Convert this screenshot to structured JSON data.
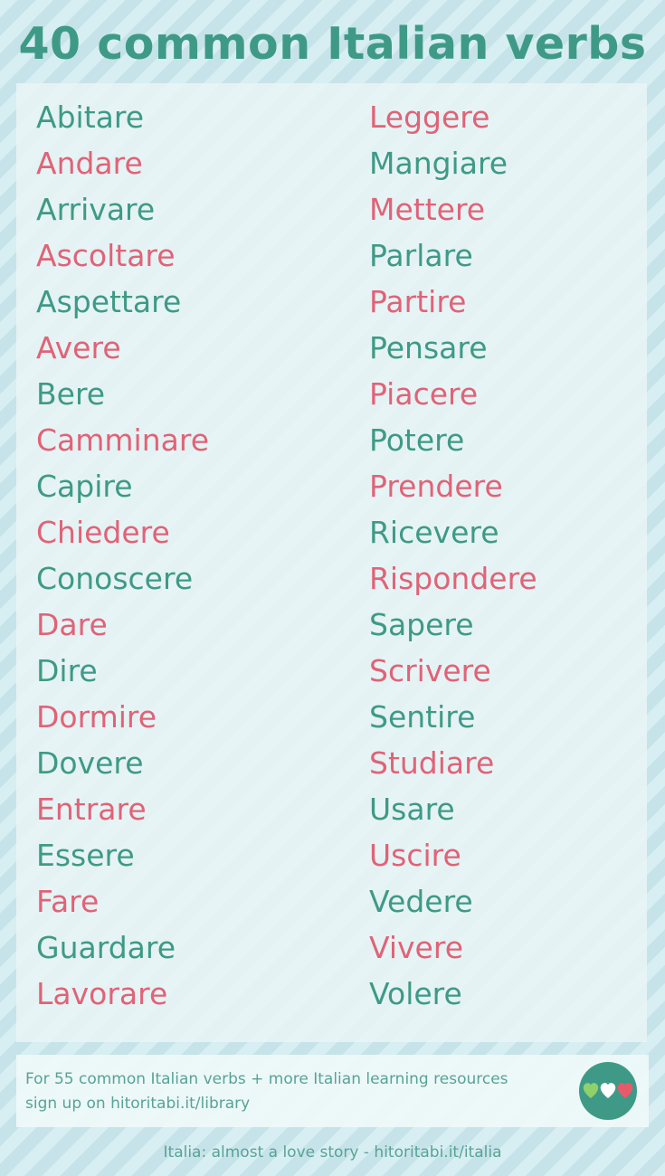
{
  "title": "40 common Italian verbs",
  "colors": {
    "green": "#3e9a86",
    "pink": "#e06377",
    "heart_left": "#8fd16a",
    "heart_mid": "#ffffff",
    "heart_right": "#e85a6a"
  },
  "verbs_left": [
    "Abitare",
    "Andare",
    "Arrivare",
    "Ascoltare",
    "Aspettare",
    "Avere",
    "Bere",
    "Camminare",
    "Capire",
    "Chiedere",
    "Conoscere",
    "Dare",
    "Dire",
    "Dormire",
    "Dovere",
    "Entrare",
    "Essere",
    "Fare",
    "Guardare",
    "Lavorare"
  ],
  "verbs_right": [
    "Leggere",
    "Mangiare",
    "Mettere",
    "Parlare",
    "Partire",
    "Pensare",
    "Piacere",
    "Potere",
    "Prendere",
    "Ricevere",
    "Rispondere",
    "Sapere",
    "Scrivere",
    "Sentire",
    "Studiare",
    "Usare",
    "Uscire",
    "Vedere",
    "Vivere",
    "Volere"
  ],
  "footer": {
    "text": "For 55 common Italian verbs + more Italian learning resources sign up on hitoritabi.it/library",
    "logo_icon": "three-hearts-icon"
  },
  "credit": "Italia: almost a love story - hitoritabi.it/italia"
}
